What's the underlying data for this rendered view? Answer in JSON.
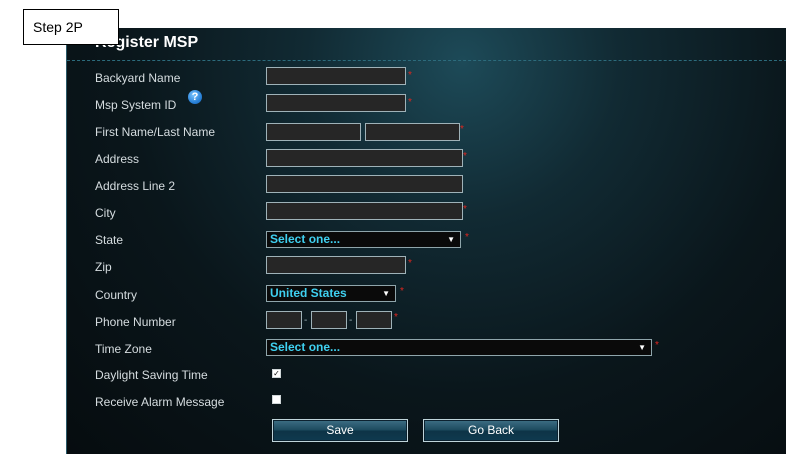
{
  "annotation": {
    "step_label": "Step 2P"
  },
  "form": {
    "title": "Register MSP",
    "labels": {
      "backyard_name": "Backyard Name",
      "msp_system_id": "Msp System ID",
      "first_last_name": "First Name/Last Name",
      "address": "Address",
      "address_line_2": "Address Line 2",
      "city": "City",
      "state": "State",
      "zip": "Zip",
      "country": "Country",
      "phone_number": "Phone Number",
      "time_zone": "Time Zone",
      "daylight_saving_time": "Daylight Saving Time",
      "receive_alarm_message": "Receive Alarm Message"
    },
    "values": {
      "backyard_name": "",
      "msp_system_id": "",
      "first_name": "",
      "last_name": "",
      "address": "",
      "address_line_2": "",
      "city": "",
      "state": "Select one...",
      "zip": "",
      "country": "United States",
      "phone_1": "",
      "phone_2": "",
      "phone_3": "",
      "time_zone": "Select one...",
      "daylight_saving_time": true,
      "receive_alarm_message": false
    },
    "required_marker": "*",
    "help_icon": "?",
    "select_arrow": "▼",
    "check_mark": "✓",
    "phone_separator": "-",
    "buttons": {
      "save": "Save",
      "go_back": "Go Back"
    }
  },
  "colors": {
    "required": "#e0261e",
    "select_text": "#3fd0f0",
    "help_icon": "#2a82d8"
  }
}
